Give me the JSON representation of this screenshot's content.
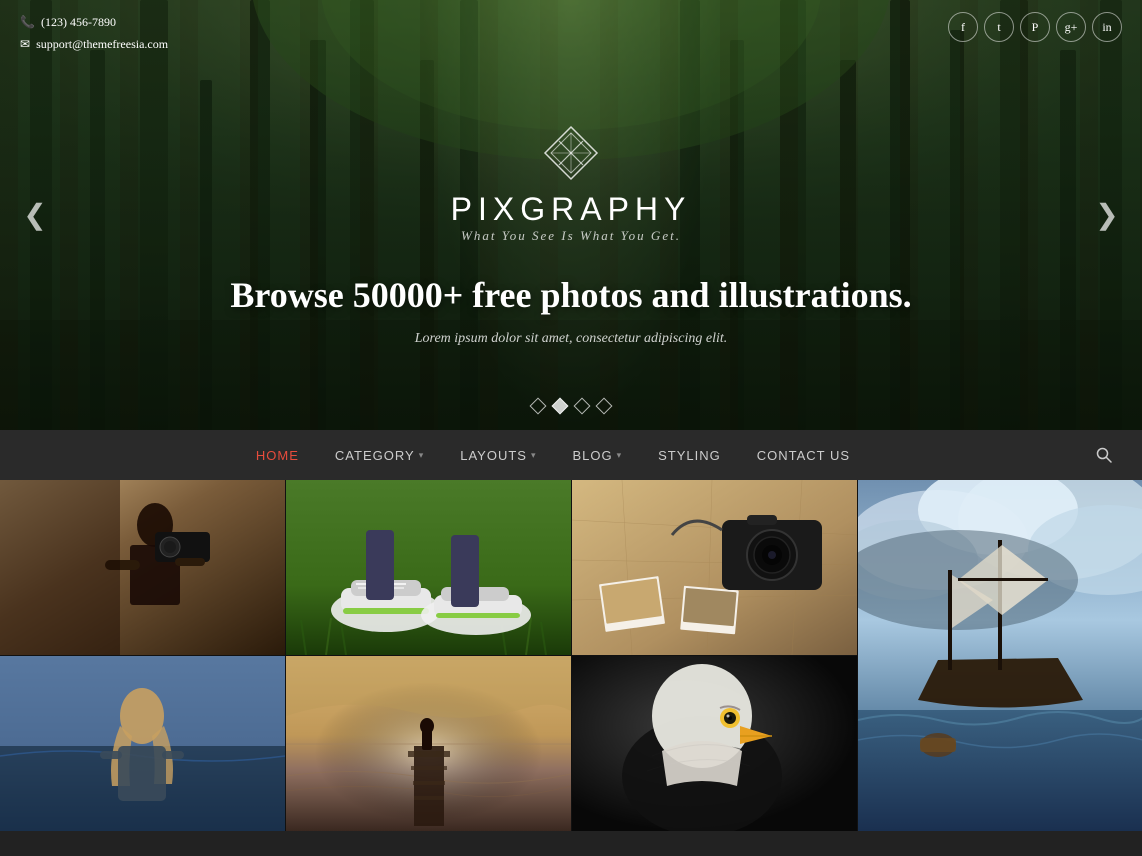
{
  "site": {
    "title": "PIXGRAPHY",
    "tagline": "What You See Is What You Get.",
    "hero_heading": "Browse 50000+ free photos and illustrations.",
    "hero_sub": "Lorem ipsum dolor sit amet, consectetur adipiscing elit.",
    "logo_icon": "◈"
  },
  "contact": {
    "phone": "(123) 456-7890",
    "email": "support@themefreesia.com"
  },
  "social": [
    {
      "name": "facebook",
      "symbol": "f"
    },
    {
      "name": "twitter",
      "symbol": "t"
    },
    {
      "name": "pinterest",
      "symbol": "P"
    },
    {
      "name": "google-plus",
      "symbol": "g+"
    },
    {
      "name": "instagram",
      "symbol": "in"
    }
  ],
  "nav": {
    "items": [
      {
        "label": "HOME",
        "active": true,
        "has_dropdown": false
      },
      {
        "label": "CATEGORY",
        "active": false,
        "has_dropdown": true
      },
      {
        "label": "LAYOUTS",
        "active": false,
        "has_dropdown": true
      },
      {
        "label": "BLOG",
        "active": false,
        "has_dropdown": true
      },
      {
        "label": "STYLING",
        "active": false,
        "has_dropdown": false
      },
      {
        "label": "CONTACT US",
        "active": false,
        "has_dropdown": false
      }
    ]
  },
  "slider": {
    "dots": [
      {
        "active": false
      },
      {
        "active": true
      },
      {
        "active": false
      },
      {
        "active": false
      }
    ]
  },
  "photos": [
    {
      "id": "camera",
      "description": "Person filming with camera"
    },
    {
      "id": "shoes",
      "description": "Sneakers on grass"
    },
    {
      "id": "map",
      "description": "Camera on map"
    },
    {
      "id": "ship",
      "description": "Ship in stormy sea"
    },
    {
      "id": "girl",
      "description": "Girl looking at water"
    },
    {
      "id": "horizon",
      "description": "Person on horizon jetty"
    },
    {
      "id": "eagle",
      "description": "Bald eagle portrait"
    }
  ],
  "colors": {
    "active_nav": "#e74c3c",
    "nav_bg": "#2a2a2a",
    "hero_overlay": "rgba(0,0,0,0.4)"
  }
}
